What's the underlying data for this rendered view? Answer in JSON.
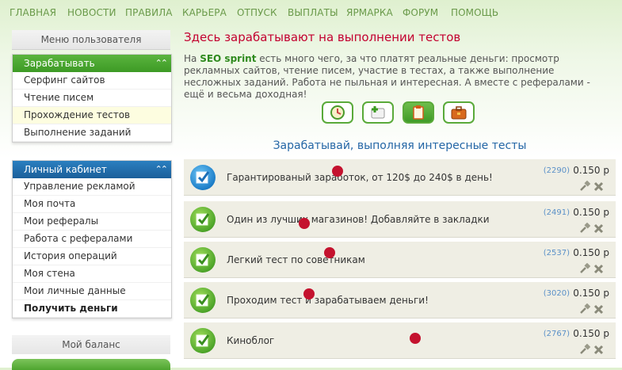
{
  "nav": [
    "ГЛАВНАЯ",
    "НОВОСТИ",
    "ПРАВИЛА",
    "КАРЬЕРА",
    "ОТПУСК",
    "ВЫПЛАТЫ",
    "ЯРМАРКА",
    "ФОРУМ",
    "ПОМОЩЬ"
  ],
  "sidebar": {
    "title": "Меню пользователя",
    "earn": {
      "head": "Зарабатывать",
      "items": [
        "Серфинг сайтов",
        "Чтение писем",
        "Прохождение тестов",
        "Выполнение заданий"
      ]
    },
    "cabinet": {
      "head": "Личный кабинет",
      "items": [
        "Управление рекламой",
        "Моя почта",
        "Мои рефералы",
        "Работа с рефералами",
        "История операций",
        "Моя стена",
        "Мои личные данные",
        "Получить деньги"
      ]
    },
    "balance_title": "Мой баланс"
  },
  "main": {
    "title": "Здесь зарабатывают на выполнении тестов",
    "intro_pre": "На ",
    "intro_brand": "SEO sprint",
    "intro_post": " есть много чего, за что платят реальные деньги: просмотр рекламных сайтов, чтение писем, участие в тестах, а также выполнение несложных заданий. Работа не пыльная и интересная. А вместе с рефералами - ещё и весьма доходная!",
    "subtitle": "Зарабатывай, выполняя интересные тесты",
    "tasks": [
      {
        "label": "Гарантированый заработок, от 120$ до 240$ в день!",
        "count": "(2290)",
        "price": "0.150 р",
        "icon": "blue"
      },
      {
        "label": "Один из лучших магазинов! Добавляйте в закладки",
        "count": "(2491)",
        "price": "0.150 р",
        "icon": "green"
      },
      {
        "label": "Легкий тест по советникам",
        "count": "(2537)",
        "price": "0.150 р",
        "icon": "green"
      },
      {
        "label": "Проходим тест и зарабатываем деньги!",
        "count": "(3020)",
        "price": "0.150 р",
        "icon": "green"
      },
      {
        "label": "Киноблог",
        "count": "(2767)",
        "price": "0.150 р",
        "icon": "green"
      }
    ]
  },
  "icons": [
    "clock-icon",
    "add-icon",
    "notepad-icon",
    "briefcase-icon",
    "check-icon",
    "hammer-icon",
    "close-icon"
  ],
  "colors": {
    "accent_green": "#3d9a25",
    "accent_blue": "#1b5f9a",
    "title_red": "#c3002f",
    "marker_red": "#c4122e"
  }
}
